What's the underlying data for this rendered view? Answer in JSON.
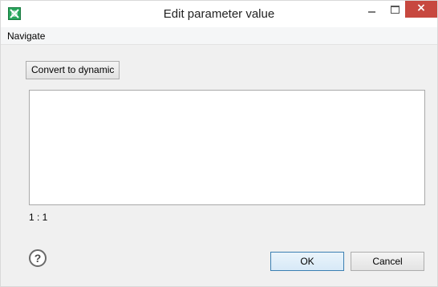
{
  "window": {
    "title": "Edit parameter value",
    "close_label": "×",
    "accent_close": "#c7483f",
    "icons": {
      "app": "app-green-icon",
      "minimize": "minimize-icon",
      "maximize": "maximize-icon",
      "close": "close-icon"
    }
  },
  "menu": {
    "items": [
      {
        "label": "Navigate"
      }
    ]
  },
  "toolbar": {
    "convert_label": "Convert to dynamic"
  },
  "editor": {
    "value": "",
    "cursor_position": "1 : 1"
  },
  "footer": {
    "help_glyph": "?",
    "ok_label": "OK",
    "cancel_label": "Cancel"
  }
}
